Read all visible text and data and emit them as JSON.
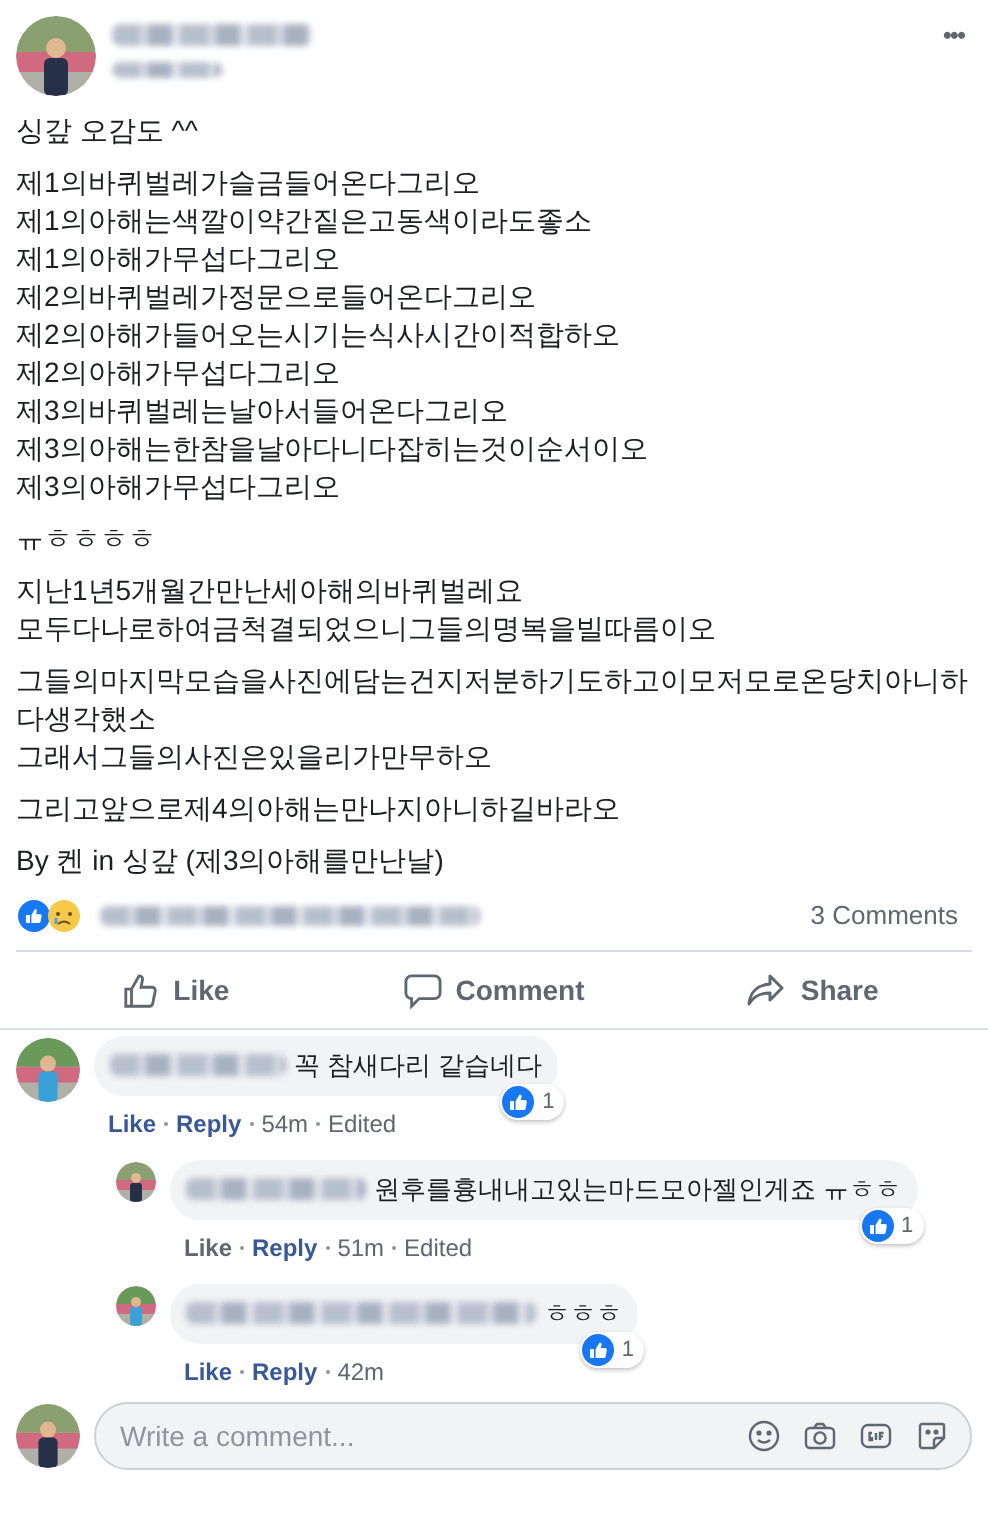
{
  "post": {
    "menu_icon": "•••",
    "paragraphs": [
      [
        "싱갚 오감도 ^^"
      ],
      [
        "제1의바퀴벌레가슬금들어온다그리오",
        "제1의아해는색깔이약간짙은고동색이라도좋소",
        "제1의아해가무섭다그리오",
        "제2의바퀴벌레가정문으로들어온다그리오",
        "제2의아해가들어오는시기는식사시간이적합하오",
        "제2의아해가무섭다그리오",
        "제3의바퀴벌레는날아서들어온다그리오",
        "제3의아해는한참을날아다니다잡히는것이순서이오",
        "제3의아해가무섭다그리오"
      ],
      [
        "ㅠㅎㅎㅎㅎ"
      ],
      [
        "지난1년5개월간만난세아해의바퀴벌레요",
        "모두다나로하여금척결되었으니그들의명복을빌따름이오"
      ],
      [
        "그들의마지막모습을사진에담는건지저분하기도하고이모저모로온당치아니하",
        "다생각했소",
        "그래서그들의사진은있을리가만무하오"
      ],
      [
        "그리고앞으로제4의아해는만나지아니하길바라오"
      ],
      [
        "By 켄 in 싱갚 (제3의아해를만난날)"
      ]
    ],
    "comments_count": "3 Comments"
  },
  "actions": [
    {
      "kind": "like",
      "label": "Like"
    },
    {
      "kind": "comment",
      "label": "Comment"
    },
    {
      "kind": "share",
      "label": "Share"
    }
  ],
  "comments": [
    {
      "text": "꼭 참새다리 같습네다",
      "likes": "1",
      "liked": true,
      "time": "54m",
      "edited": "Edited",
      "like_label": "Like",
      "reply_label": "Reply",
      "children": [
        {
          "text": "원후를흉내내고있는마드모아젤인게죠 ㅠㅎㅎ",
          "likes": "1",
          "liked": false,
          "time": "51m",
          "edited": "Edited",
          "like_label": "Like",
          "reply_label": "Reply"
        },
        {
          "text": "ㅎㅎㅎ",
          "likes": "1",
          "liked": true,
          "time": "42m",
          "like_label": "Like",
          "reply_label": "Reply"
        }
      ]
    }
  ],
  "composer": {
    "placeholder": "Write a comment..."
  }
}
